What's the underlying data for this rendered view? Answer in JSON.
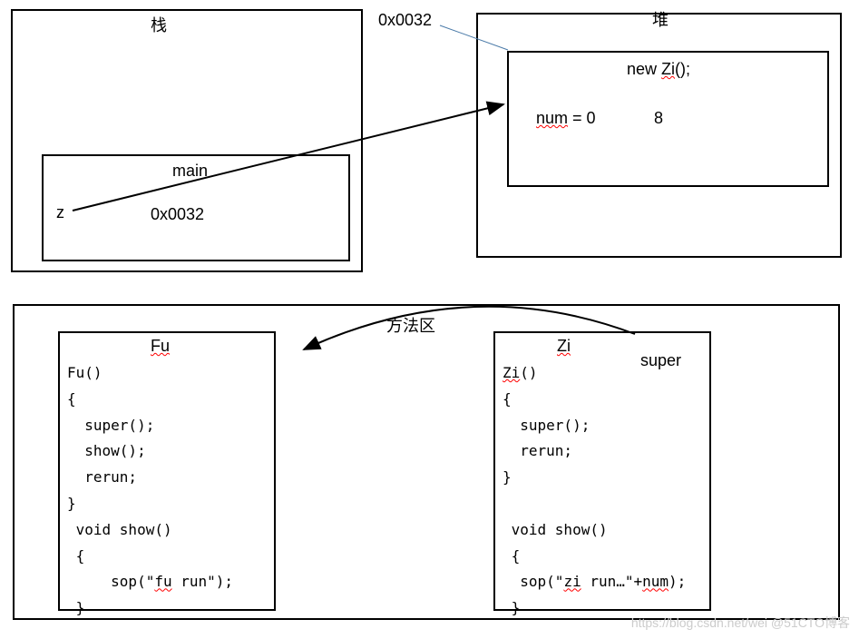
{
  "stack": {
    "title": "栈",
    "main_label": "main",
    "var_name": "z",
    "var_value": "0x0032"
  },
  "heap": {
    "title": "堆",
    "address_label": "0x0032",
    "new_expr": "new  Zi();",
    "num_label": "num = 0",
    "num_value": "8"
  },
  "method_area": {
    "title": "方法区",
    "fu": {
      "name": "Fu",
      "code": "Fu()\n{\n  super();\n  show();\n  rerun;\n}\n void show()\n {\n     sop(\"fu run\");\n }"
    },
    "zi": {
      "name": "Zi",
      "super_label": "super",
      "code": "Zi()\n{\n  super();\n  rerun;\n}\n\n void show()\n {\n  sop(\"zi run…\"+num);\n }"
    }
  },
  "watermark": "https://blog.csdn.net/wei @51CTO博客"
}
